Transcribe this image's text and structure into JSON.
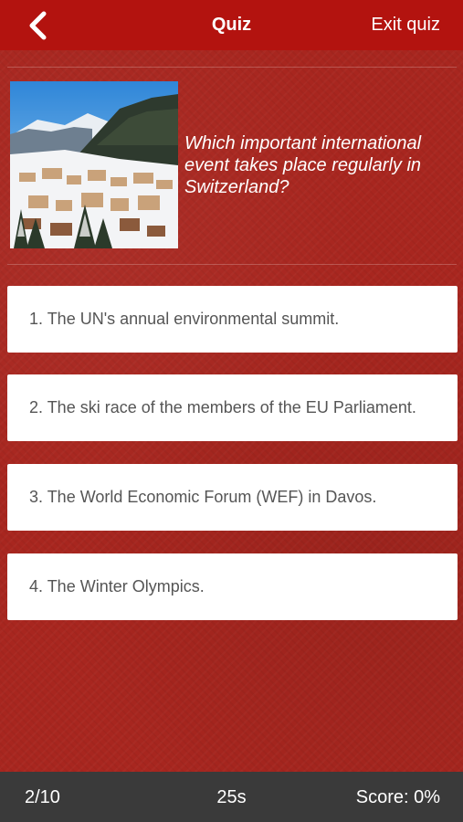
{
  "header": {
    "back_icon": "chevron-left-icon",
    "title": "Quiz",
    "exit_label": "Exit quiz"
  },
  "question": {
    "text": "Which important international event takes place regularly in Switzerland?"
  },
  "answers": [
    {
      "label": "1. The UN's annual environmental summit."
    },
    {
      "label": "2. The ski race of the members of the EU Parliament."
    },
    {
      "label": "3. The World Economic Forum (WEF) in Davos."
    },
    {
      "label": "4. The Winter Olympics."
    }
  ],
  "footer": {
    "progress": "2/10",
    "timer": "25s",
    "score": "Score: 0%"
  },
  "colors": {
    "background": "#a8261f",
    "nav_bar": "#b3130f",
    "footer": "#3a3a3a",
    "answer_bg": "#ffffff",
    "answer_text": "#555555"
  }
}
